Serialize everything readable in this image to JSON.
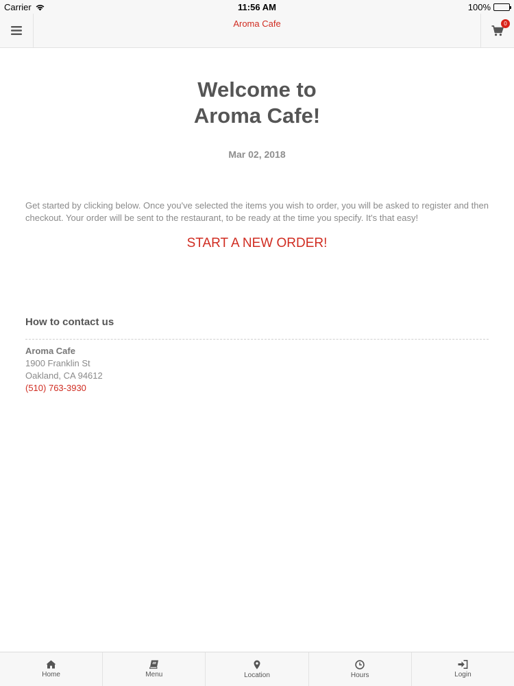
{
  "status_bar": {
    "carrier": "Carrier",
    "time": "11:56 AM",
    "battery": "100%"
  },
  "nav": {
    "title": "Aroma Cafe",
    "cart_count": "0",
    "menu_icon": "hamburger-icon",
    "cart_icon": "shopping-cart-icon"
  },
  "welcome": {
    "line1": "Welcome to",
    "line2": "Aroma Cafe!"
  },
  "date": "Mar 02, 2018",
  "intro_text": "Get started by clicking below. Once you've selected the items you wish to order, you will be asked to register and then checkout. Your order will be sent to the restaurant, to be ready at the time you specify. It's that easy!",
  "start_order_label": "START A NEW ORDER!",
  "contact": {
    "heading": "How to contact us",
    "name": "Aroma Cafe",
    "address1": "1900 Franklin St",
    "address2": "Oakland, CA 94612",
    "phone": "(510) 763-3930"
  },
  "tabs": [
    {
      "label": "Home",
      "icon": "home-icon"
    },
    {
      "label": "Menu",
      "icon": "book-icon"
    },
    {
      "label": "Location",
      "icon": "map-pin-icon"
    },
    {
      "label": "Hours",
      "icon": "clock-icon"
    },
    {
      "label": "Login",
      "icon": "sign-in-icon"
    }
  ],
  "colors": {
    "accent": "#d02c21",
    "text_dark": "#555555",
    "text_muted": "#8a8a8a",
    "bar_background": "#f7f7f7"
  }
}
